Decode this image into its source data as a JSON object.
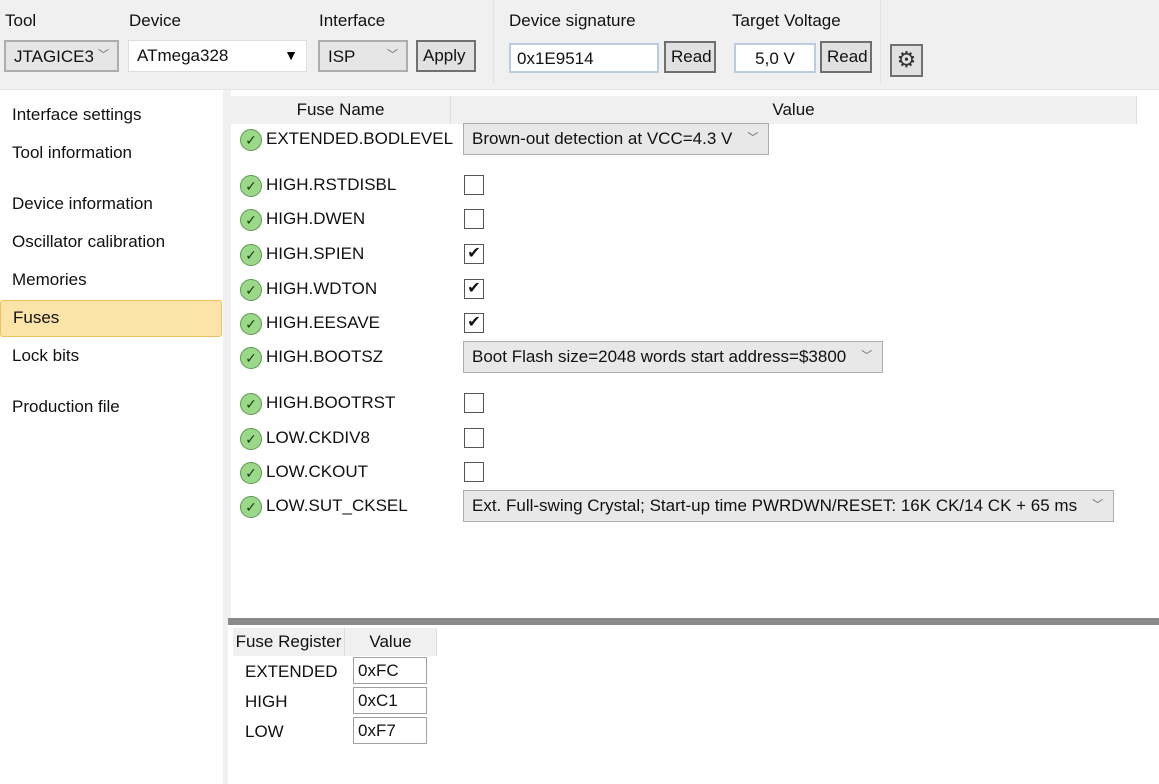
{
  "toolbar": {
    "tool_label": "Tool",
    "tool_value": "JTAGICE3",
    "device_label": "Device",
    "device_value": "ATmega328",
    "interface_label": "Interface",
    "interface_value": "ISP",
    "apply_label": "Apply",
    "signature_label": "Device signature",
    "signature_value": "0x1E9514",
    "read_signature_label": "Read",
    "voltage_label": "Target Voltage",
    "voltage_value": "5,0 V",
    "read_voltage_label": "Read",
    "settings_icon": "gear-icon"
  },
  "sidebar": {
    "items": [
      {
        "label": "Interface settings"
      },
      {
        "label": "Tool information"
      },
      {
        "label": "Device information"
      },
      {
        "label": "Oscillator calibration"
      },
      {
        "label": "Memories"
      },
      {
        "label": "Fuses",
        "selected": true
      },
      {
        "label": "Lock bits"
      },
      {
        "label": "Production file"
      }
    ]
  },
  "fuses": {
    "columns": [
      "Fuse Name",
      "Value"
    ],
    "rows": [
      {
        "name": "EXTENDED.BODLEVEL",
        "type": "select",
        "value": "Brown-out detection at VCC=4.3 V"
      },
      {
        "name": "HIGH.RSTDISBL",
        "type": "checkbox",
        "checked": false
      },
      {
        "name": "HIGH.DWEN",
        "type": "checkbox",
        "checked": false
      },
      {
        "name": "HIGH.SPIEN",
        "type": "checkbox",
        "checked": true
      },
      {
        "name": "HIGH.WDTON",
        "type": "checkbox",
        "checked": true
      },
      {
        "name": "HIGH.EESAVE",
        "type": "checkbox",
        "checked": true
      },
      {
        "name": "HIGH.BOOTSZ",
        "type": "select",
        "value": "Boot Flash size=2048 words start address=$3800"
      },
      {
        "name": "HIGH.BOOTRST",
        "type": "checkbox",
        "checked": false
      },
      {
        "name": "LOW.CKDIV8",
        "type": "checkbox",
        "checked": false
      },
      {
        "name": "LOW.CKOUT",
        "type": "checkbox",
        "checked": false
      },
      {
        "name": "LOW.SUT_CKSEL",
        "type": "select",
        "value": "Ext. Full-swing Crystal; Start-up time PWRDWN/RESET: 16K CK/14 CK + 65 ms"
      }
    ]
  },
  "registers": {
    "columns": [
      "Fuse Register",
      "Value"
    ],
    "rows": [
      {
        "name": "EXTENDED",
        "value": "0xFC"
      },
      {
        "name": "HIGH",
        "value": "0xC1"
      },
      {
        "name": "LOW",
        "value": "0xF7"
      }
    ]
  }
}
